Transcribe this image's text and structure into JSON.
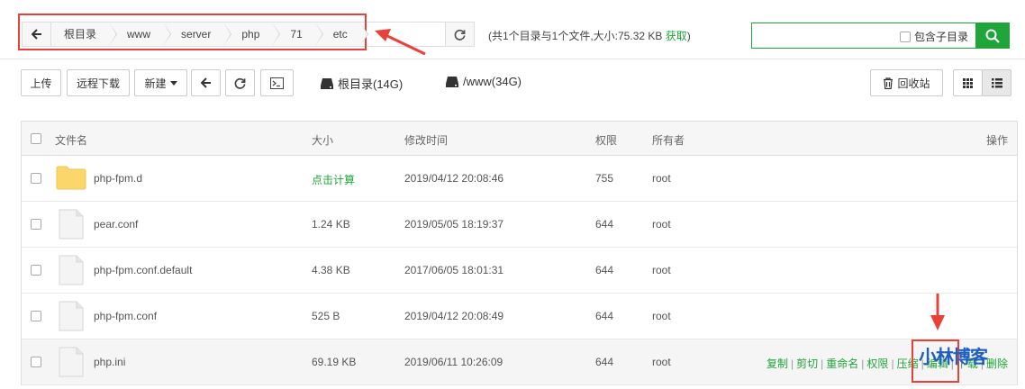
{
  "breadcrumbs": [
    "根目录",
    "www",
    "server",
    "php",
    "71",
    "etc"
  ],
  "dir_summary": {
    "text": "(共1个目录与1个文件,大小:75.32 KB",
    "fetch_label": "获取",
    "close": ")"
  },
  "search": {
    "placeholder": "",
    "subdir_label": "包含子目录"
  },
  "toolbar": {
    "upload_label": "上传",
    "remote_download_label": "远程下载",
    "new_label": "新建",
    "disk_root_label": "根目录(14G)",
    "disk_www_label": "/www(34G)",
    "recycle_label": "回收站"
  },
  "columns": {
    "name": "文件名",
    "size": "大小",
    "mtime": "修改时间",
    "perm": "权限",
    "owner": "所有者",
    "ops": "操作"
  },
  "rows": [
    {
      "name": "php-fpm.d",
      "type": "folder",
      "size": "点击计算",
      "mtime": "2019/04/12 20:08:46",
      "perm": "755",
      "owner": "root"
    },
    {
      "name": "pear.conf",
      "type": "file",
      "size": "1.24 KB",
      "mtime": "2019/05/05 18:19:37",
      "perm": "644",
      "owner": "root"
    },
    {
      "name": "php-fpm.conf.default",
      "type": "file",
      "size": "4.38 KB",
      "mtime": "2017/06/05 18:01:31",
      "perm": "644",
      "owner": "root"
    },
    {
      "name": "php-fpm.conf",
      "type": "file",
      "size": "525 B",
      "mtime": "2019/04/12 20:08:49",
      "perm": "644",
      "owner": "root"
    },
    {
      "name": "php.ini",
      "type": "file",
      "size": "69.19 KB",
      "mtime": "2019/06/11 10:26:09",
      "perm": "644",
      "owner": "root"
    }
  ],
  "row_actions": [
    "复制",
    "剪切",
    "重命名",
    "权限",
    "压缩",
    "编辑",
    "下载",
    "删除"
  ],
  "watermark": "小林博客",
  "colors": {
    "accent": "#20a53a",
    "annotation": "#e8413a",
    "watermark": "#1f5fbf"
  },
  "icons": [
    "back-arrow-icon",
    "refresh-icon",
    "search-icon",
    "caret-down-icon",
    "terminal-icon",
    "disk-icon",
    "trash-icon",
    "grid-view-icon",
    "list-view-icon",
    "folder-icon",
    "file-icon"
  ]
}
